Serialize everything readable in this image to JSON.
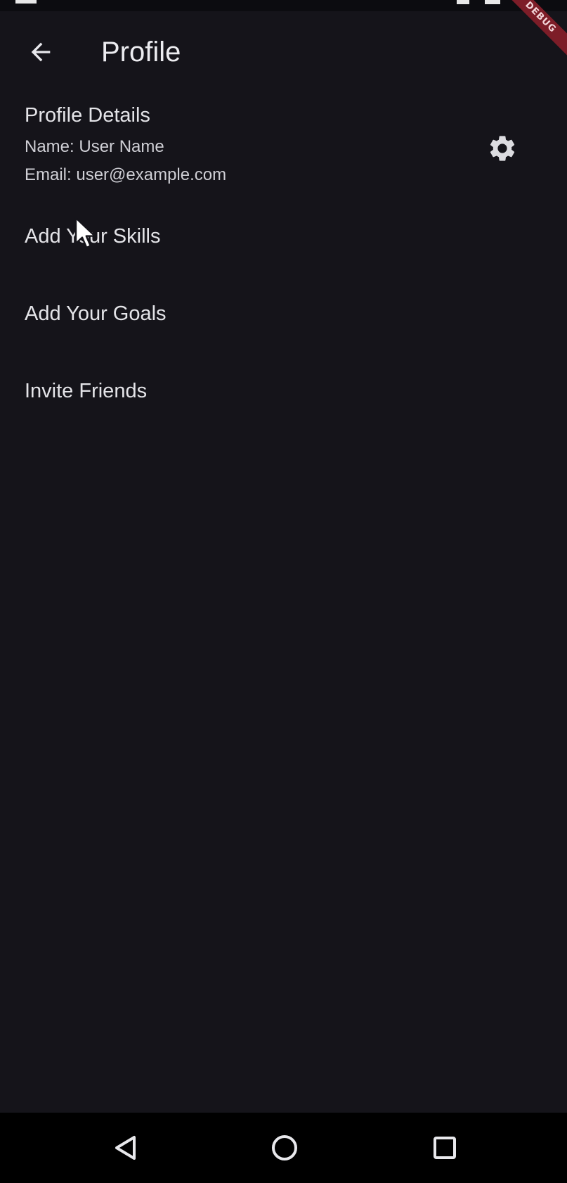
{
  "app_bar": {
    "title": "Profile",
    "back_icon": "arrow-left-icon"
  },
  "debug_banner": {
    "label": "DEBUG",
    "color": "#7d1d28"
  },
  "profile_details": {
    "title": "Profile Details",
    "name_line": "Name: User Name",
    "email_line": "Email: user@example.com",
    "settings_icon": "gear-icon"
  },
  "menu": {
    "items": [
      {
        "label": "Add Your Skills"
      },
      {
        "label": "Add Your Goals"
      },
      {
        "label": "Invite Friends"
      }
    ]
  },
  "navigation_bar": {
    "back_icon": "triangle-back-icon",
    "home_icon": "circle-home-icon",
    "recents_icon": "square-recents-icon"
  },
  "theme": {
    "background": "#15141a",
    "text": "#e4e4e8"
  }
}
